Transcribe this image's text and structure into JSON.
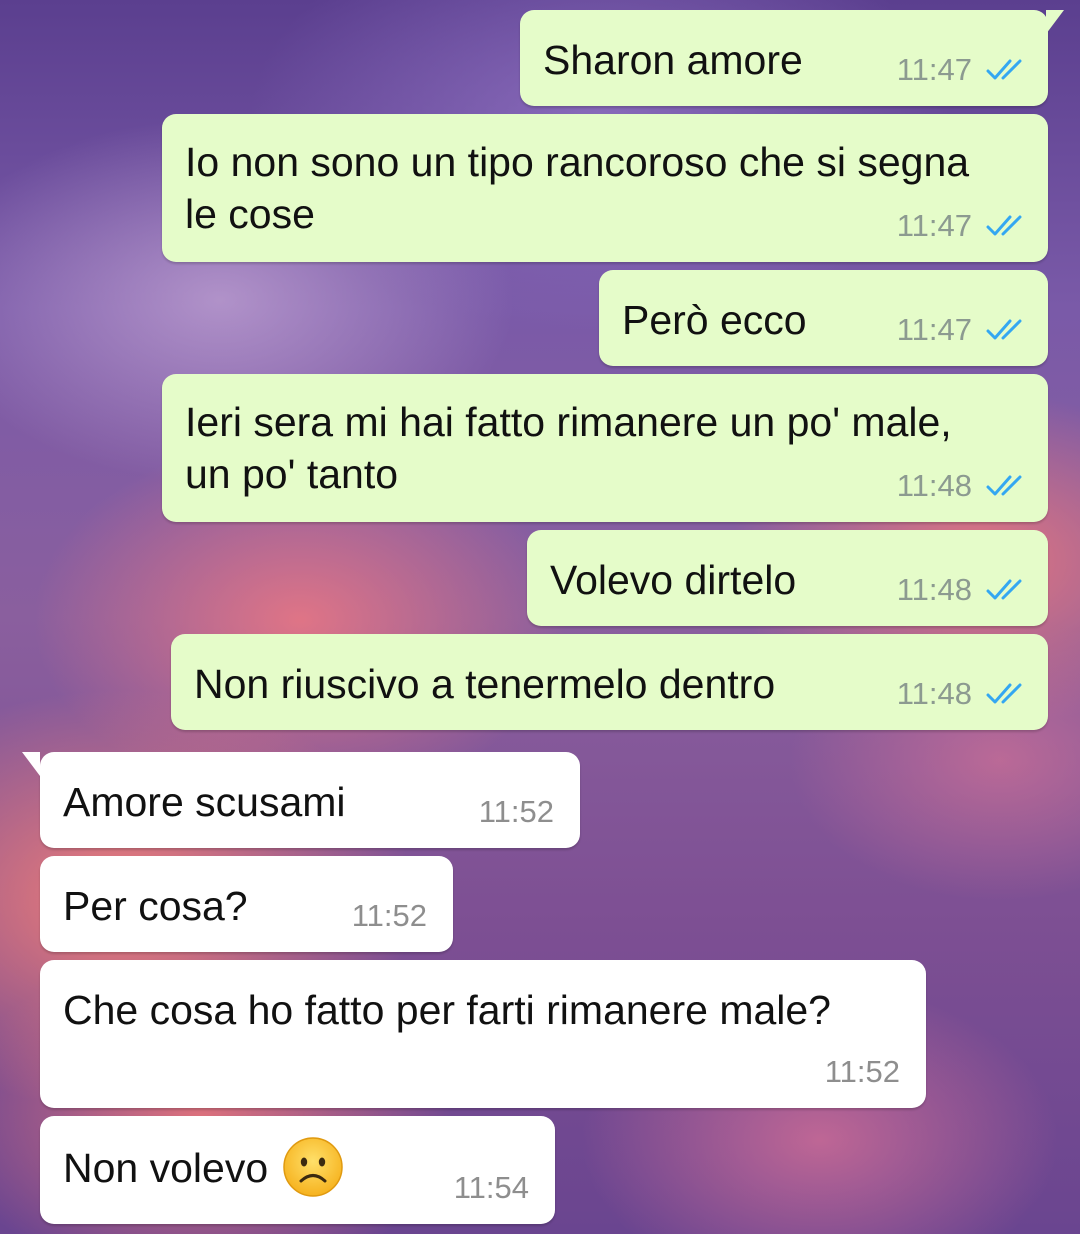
{
  "conversation": {
    "messages": [
      {
        "direction": "outgoing",
        "lines": [
          "Sharon amore"
        ],
        "time": "11:47",
        "status": "read"
      },
      {
        "direction": "outgoing",
        "lines": [
          "Io non sono un tipo rancoroso che si segna",
          "le cose"
        ],
        "time": "11:47",
        "status": "read"
      },
      {
        "direction": "outgoing",
        "lines": [
          "Però ecco"
        ],
        "time": "11:47",
        "status": "read"
      },
      {
        "direction": "outgoing",
        "lines": [
          "Ieri sera mi hai fatto rimanere un po' male,",
          "un po' tanto"
        ],
        "time": "11:48",
        "status": "read"
      },
      {
        "direction": "outgoing",
        "lines": [
          "Volevo dirtelo"
        ],
        "time": "11:48",
        "status": "read"
      },
      {
        "direction": "outgoing",
        "lines": [
          "Non riuscivo a tenermelo dentro"
        ],
        "time": "11:48",
        "status": "read"
      },
      {
        "direction": "incoming",
        "lines": [
          "Amore scusami"
        ],
        "time": "11:52"
      },
      {
        "direction": "incoming",
        "lines": [
          "Per cosa?"
        ],
        "time": "11:52"
      },
      {
        "direction": "incoming",
        "lines": [
          "Che cosa ho fatto per farti rimanere male?"
        ],
        "time": "11:52"
      },
      {
        "direction": "incoming",
        "lines": [
          "Non volevo"
        ],
        "emoji": "frowning-face-emoji",
        "time": "11:54"
      }
    ]
  },
  "colors": {
    "outgoing_bubble": "#e5fcc9",
    "incoming_bubble": "#ffffff",
    "read_ticks": "#34a7f1"
  }
}
